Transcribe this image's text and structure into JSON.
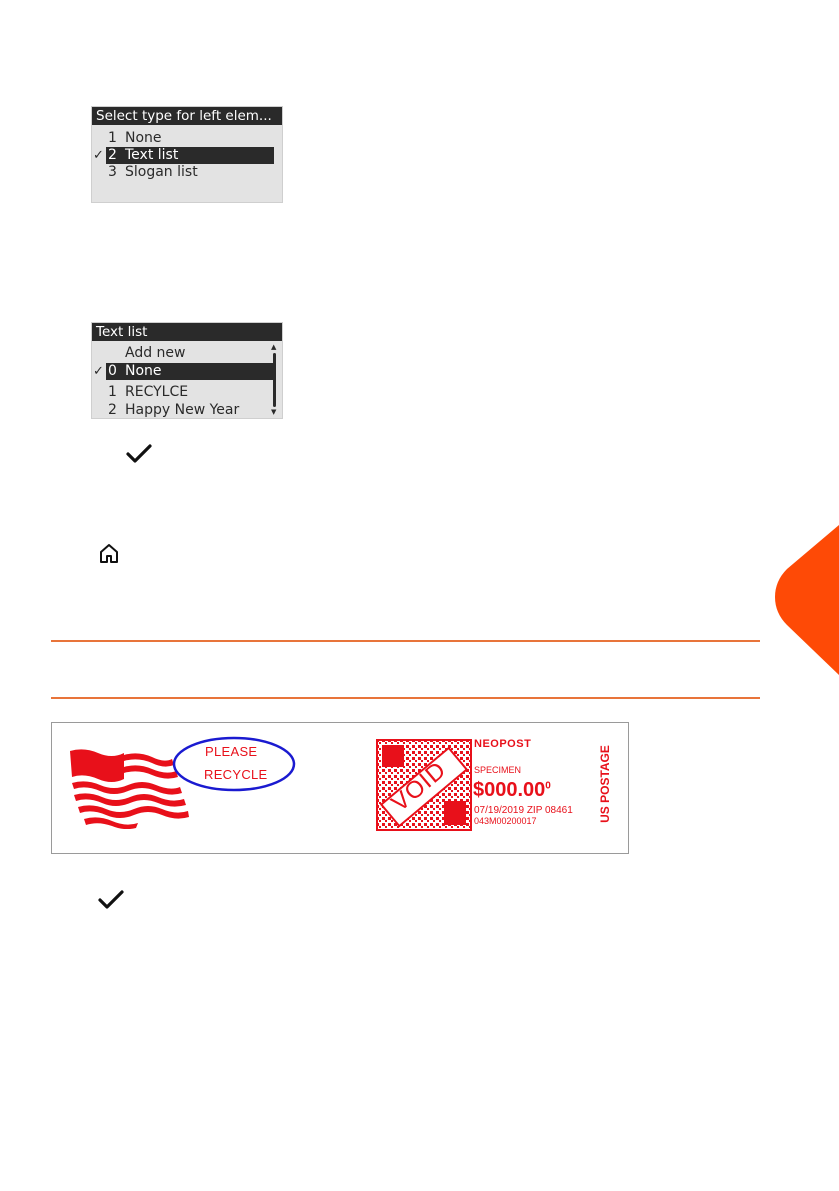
{
  "screen1": {
    "title": "Select type for left elem...",
    "items": [
      {
        "check": "",
        "num": "1",
        "label": "None"
      },
      {
        "check": "✓",
        "num": "2",
        "label": "Text list"
      },
      {
        "check": "",
        "num": "3",
        "label": "Slogan list"
      }
    ]
  },
  "screen2": {
    "title": "Text list",
    "items": [
      {
        "check": "",
        "num": "",
        "label": "Add new"
      },
      {
        "check": "✓",
        "num": "0",
        "label": "None"
      },
      {
        "check": "",
        "num": "1",
        "label": "RECYLCE"
      },
      {
        "check": "",
        "num": "2",
        "label": "Happy New Year"
      }
    ]
  },
  "icons": {
    "step_ok_1": "checkmark-icon",
    "step_home": "home-icon",
    "step_ok_2": "checkmark-icon"
  },
  "colors": {
    "accent": "#e8743a",
    "tab": "#fe4a06",
    "imprint_red": "#e8101a",
    "oval_blue": "#1a1ad0",
    "lcd_bg": "#e3e3e3",
    "lcd_dark": "#2a2a2a"
  },
  "imprint": {
    "slogan_line1": "PLEASE",
    "slogan_line2": "RECYCLE",
    "brand": "NEOPOST",
    "specimen": "SPECIMEN",
    "amount": "$000.00",
    "amount_sup": "0",
    "date_zip": "07/19/2019 ZIP 08461",
    "serial": "043M00200017",
    "void": "VOID",
    "us_postage": "US POSTAGE"
  }
}
